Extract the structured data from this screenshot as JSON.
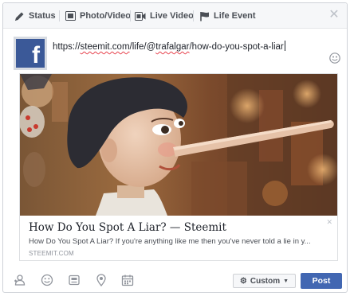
{
  "tabs": [
    {
      "label": "Status",
      "icon": "pencil-icon"
    },
    {
      "label": "Photo/Video",
      "icon": "photo-icon"
    },
    {
      "label": "Live Video",
      "icon": "video-camera-icon"
    },
    {
      "label": "Life Event",
      "icon": "flag-icon"
    }
  ],
  "composer": {
    "status_text_prefix": "https://",
    "status_text_url": "steemit.com",
    "status_text_mid": "/life/@",
    "status_text_user": "trafalgar",
    "status_text_rest": "/how-do-you-spot-a-liar",
    "avatar_letter": "f"
  },
  "preview": {
    "title": "How Do You Spot A Liar? — Steemit",
    "description": "How Do You Spot A Liar? If you're anything like me then you've never told a lie in y...",
    "domain": "STEEMIT.COM"
  },
  "actions": {
    "audience_label": "Custom",
    "post_label": "Post"
  },
  "colors": {
    "brand": "#3b5998",
    "post_button": "#4267b2"
  }
}
